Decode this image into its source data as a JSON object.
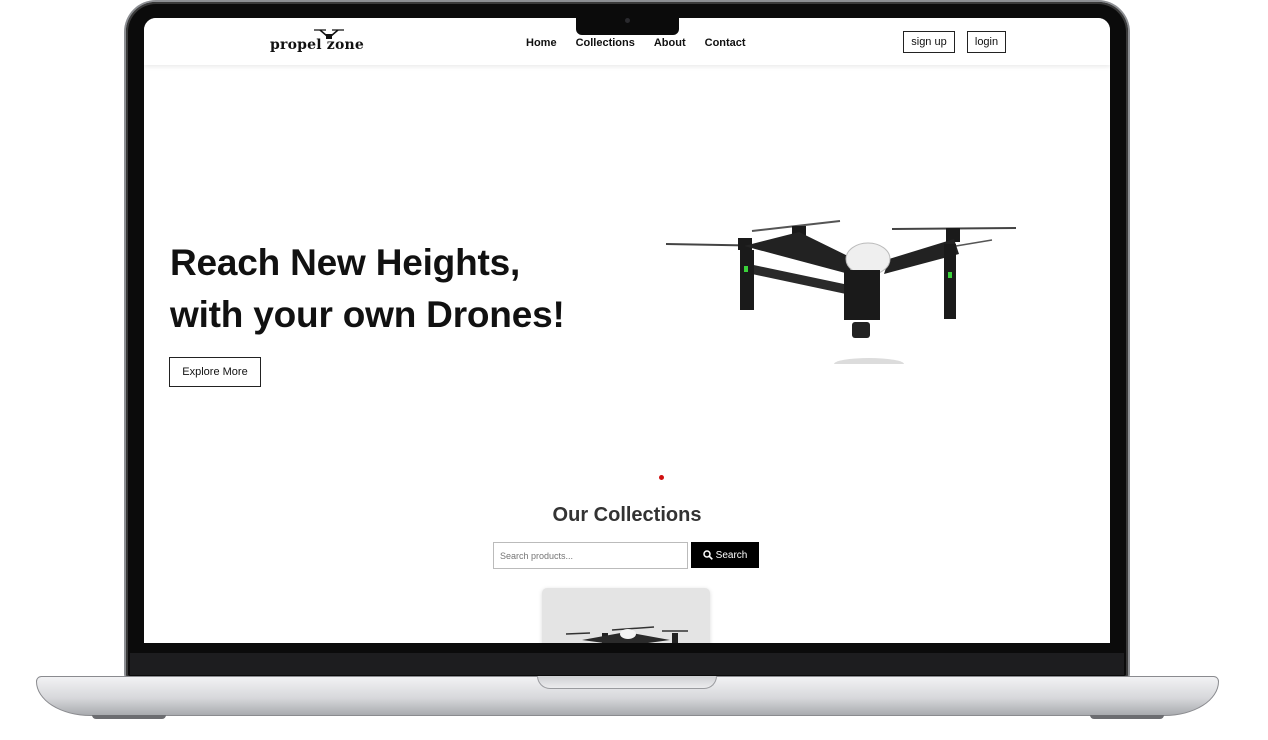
{
  "brand": {
    "logo_text": "propel zone"
  },
  "nav": {
    "links": [
      "Home",
      "Collections",
      "About",
      "Contact"
    ],
    "signup_label": "sign up",
    "login_label": "login"
  },
  "hero": {
    "title_line1": "Reach New Heights,",
    "title_line2": "with your own Drones!",
    "cta_label": "Explore More",
    "image_icon": "drone-icon",
    "carousel_dot_color": "#d01010"
  },
  "collections": {
    "title": "Our Collections",
    "search_placeholder": "Search products...",
    "search_button_label": "Search",
    "search_icon": "search-icon"
  }
}
